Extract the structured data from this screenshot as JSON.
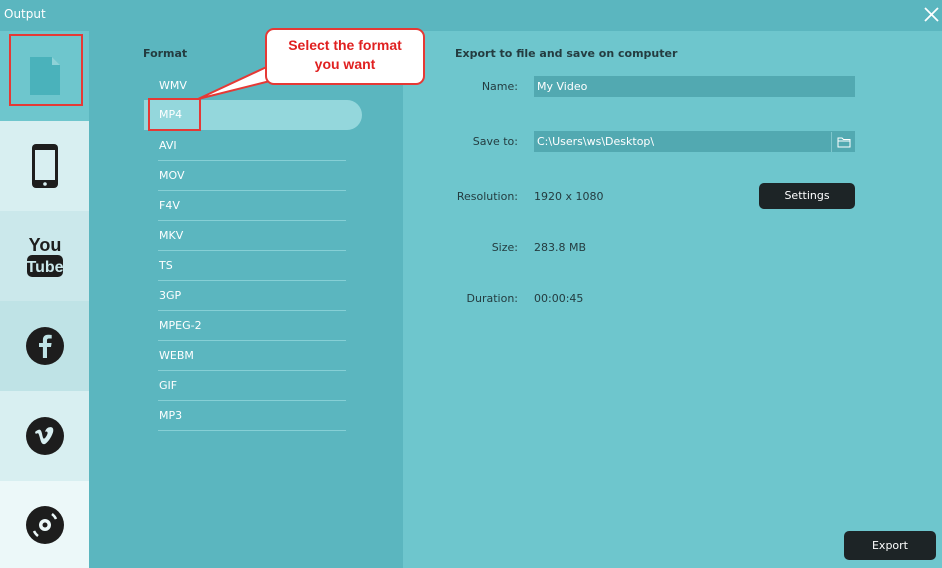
{
  "window": {
    "title": "Output",
    "close_icon": "close-icon"
  },
  "sidebar": {
    "items": [
      {
        "id": "computer",
        "icon": "file-icon",
        "selected": true
      },
      {
        "id": "device",
        "icon": "phone-icon",
        "selected": false
      },
      {
        "id": "youtube",
        "icon": "youtube-icon",
        "selected": false
      },
      {
        "id": "facebook",
        "icon": "facebook-icon",
        "selected": false
      },
      {
        "id": "vimeo",
        "icon": "vimeo-icon",
        "selected": false
      },
      {
        "id": "dvd",
        "icon": "disc-icon",
        "selected": false
      }
    ]
  },
  "format": {
    "heading": "Format",
    "items": [
      "WMV",
      "MP4",
      "AVI",
      "MOV",
      "F4V",
      "MKV",
      "TS",
      "3GP",
      "MPEG-2",
      "WEBM",
      "GIF",
      "MP3"
    ],
    "selected": "MP4"
  },
  "details": {
    "heading": "Export to file and save on computer",
    "name_label": "Name:",
    "name_value": "My Video",
    "save_label": "Save to:",
    "save_value": "C:\\Users\\ws\\Desktop\\",
    "resolution_label": "Resolution:",
    "resolution_value": "1920 x 1080",
    "settings_button": "Settings",
    "size_label": "Size:",
    "size_value": "283.8 MB",
    "duration_label": "Duration:",
    "duration_value": "00:00:45",
    "export_button": "Export"
  },
  "annotation": {
    "callout_line1": "Select the format",
    "callout_line2": "you want"
  },
  "colors": {
    "titlebar": "#5bb6bf",
    "format_panel": "#5bb6bf",
    "details_panel": "#6ec6cd",
    "selected_row": "#94d7dc",
    "highlight": "#e53935",
    "button_dark": "#1d2426"
  }
}
